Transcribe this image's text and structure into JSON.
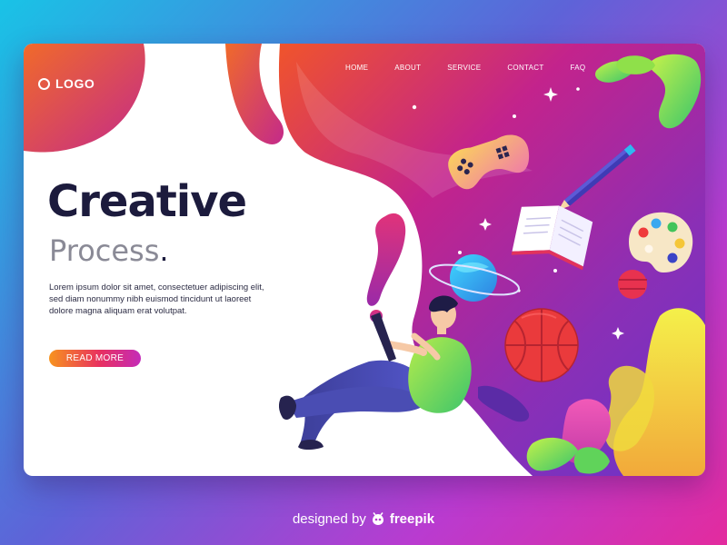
{
  "logo": {
    "text": "LOGO",
    "icon": "ring-icon"
  },
  "nav": [
    "HOME",
    "ABOUT",
    "SERVICE",
    "CONTACT",
    "FAQ"
  ],
  "hero": {
    "title": "Creative",
    "subtitle": "Process",
    "subtitle_dot": ".",
    "body": "Lorem ipsum dolor sit amet, consectetuer adipiscing elit, sed diam nonummy nibh euismod tincidunt ut laoreet dolore magna aliquam erat volutpat.",
    "button": "READ MORE"
  },
  "illustration": {
    "items": [
      "game-controller-icon",
      "pencil-icon",
      "open-book-icon",
      "paint-palette-icon",
      "ringed-planet-icon",
      "small-planet-icon",
      "basketball-icon",
      "person-with-tablet",
      "leaves-decoration",
      "sparkle-stars"
    ]
  },
  "credit": {
    "prefix": "designed by",
    "brand": "freepik",
    "icon": "freepik-logo-icon"
  },
  "colors": {
    "bg_start": "#19c3e6",
    "bg_end": "#e32b9e",
    "title": "#1c1b3d",
    "subtitle": "#8a8a96",
    "button_start": "#f7931e",
    "button_end": "#c42bb9"
  }
}
